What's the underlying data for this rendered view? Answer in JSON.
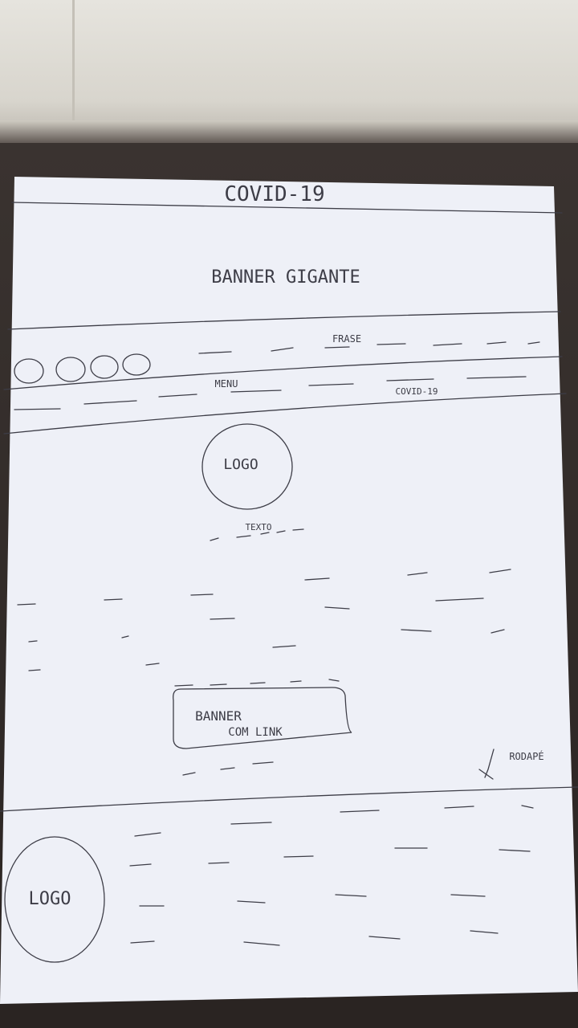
{
  "sketch": {
    "header_title": "COVID-19",
    "banner_label": "BANNER GIGANTE",
    "phrase_label": "FRASE",
    "menu_label": "MENU",
    "menu_covid_link": "COVID-19",
    "logo_label": "LOGO",
    "text_label": "TEXTO",
    "link_banner_line1": "BANNER",
    "link_banner_line2": "COM LINK",
    "footer_label": "RODAPÉ",
    "footer_logo_label": "LOGO"
  },
  "colors": {
    "paper": "#eef0f7",
    "ink": "#3d3d47",
    "table": "#2b2624",
    "wall": "#dedbd3"
  }
}
